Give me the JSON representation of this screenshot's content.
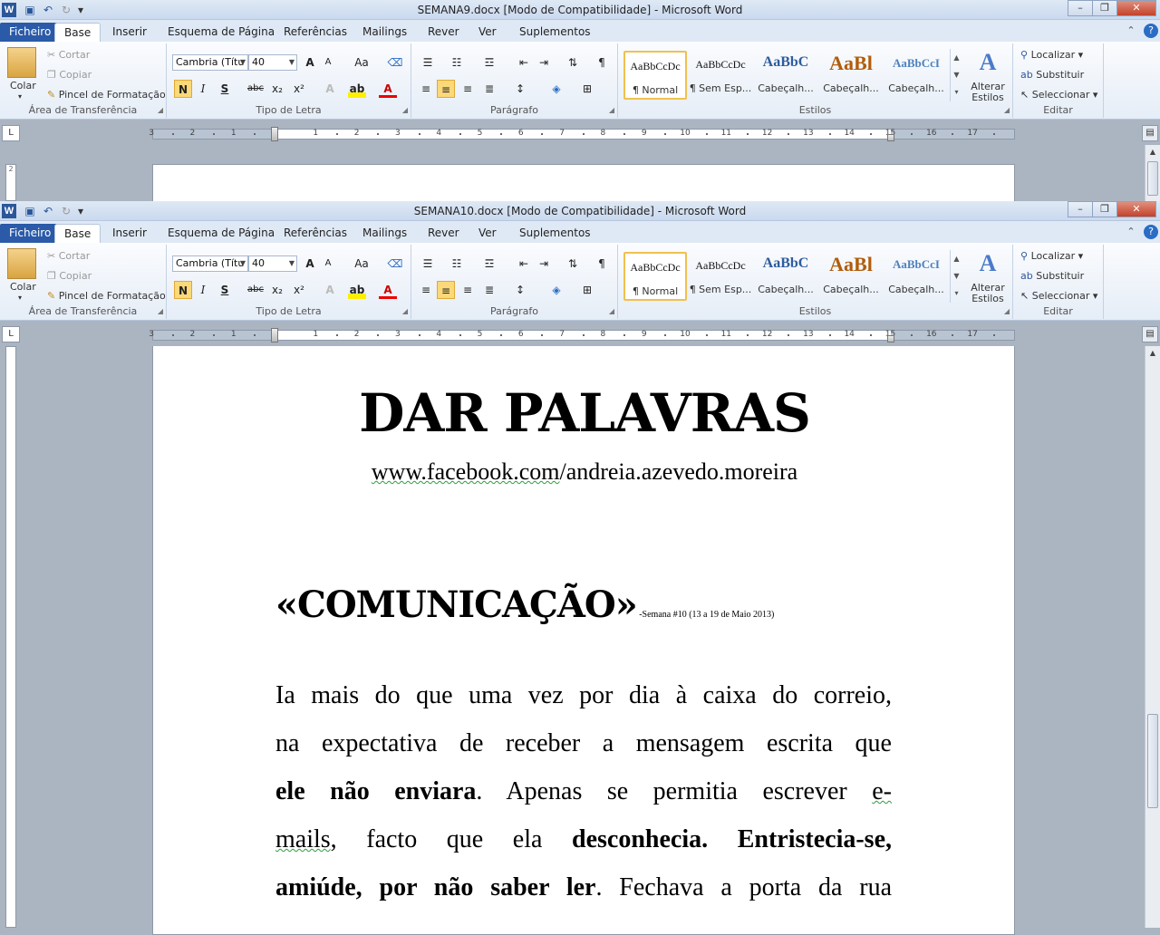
{
  "quick_access": {
    "save_icon": "save-icon",
    "undo_icon": "undo-icon",
    "redo_icon": "redo-icon",
    "customize_icon": "customize-qat-icon"
  },
  "windows": [
    {
      "title": "SEMANA9.docx [Modo de Compatibilidade]  -  Microsoft Word"
    },
    {
      "title": "SEMANA10.docx [Modo de Compatibilidade]  -  Microsoft Word"
    }
  ],
  "window_controls": {
    "minimize": "–",
    "restore": "❐",
    "close": "✕"
  },
  "tabs": [
    "Ficheiro",
    "Base",
    "Inserir",
    "Esquema de Página",
    "Referências",
    "Mailings",
    "Rever",
    "Ver",
    "Suplementos"
  ],
  "active_tab": "Base",
  "ribbon": {
    "clipboard": {
      "label": "Área de Transferência",
      "paste": "Colar",
      "cut": "Cortar",
      "copy": "Copiar",
      "format_painter": "Pincel de Formatação"
    },
    "font": {
      "label": "Tipo de Letra",
      "font_name": "Cambria (Títu",
      "font_size": "40",
      "bold": "N",
      "italic": "I",
      "underline": "S",
      "strike": "abc",
      "subscript": "x₂",
      "superscript": "x²",
      "grow": "A",
      "shrink": "A",
      "case": "Aa"
    },
    "paragraph": {
      "label": "Parágrafo",
      "pilcrow": "¶"
    },
    "styles": {
      "label": "Estilos",
      "items": [
        {
          "preview": "AaBbCcDc",
          "name": "¶ Normal",
          "selected": true
        },
        {
          "preview": "AaBbCcDc",
          "name": "¶ Sem Esp..."
        },
        {
          "preview": "AaBbC",
          "name": "Cabeçalh..."
        },
        {
          "preview": "AaBl",
          "name": "Cabeçalh..."
        },
        {
          "preview": "AaBbCcI",
          "name": "Cabeçalh..."
        }
      ],
      "change_styles": "Alterar Estilos"
    },
    "editing": {
      "label": "Editar",
      "find": "Localizar",
      "replace": "Substituir",
      "select": "Seleccionar"
    }
  },
  "ruler": {
    "numbers": [
      "3",
      "2",
      "1",
      "1",
      "2",
      "3",
      "4",
      "5",
      "6",
      "7",
      "8",
      "9",
      "10",
      "11",
      "12",
      "13",
      "14",
      "15",
      "16",
      "17"
    ]
  },
  "document": {
    "title": "DAR PALAVRAS",
    "url_part1": "www.facebook.com",
    "url_part2": "/andreia.azevedo.moreira",
    "heading": "«COMUNICAÇÃO»",
    "heading_dash": " -",
    "heading_note": "Semana #10 (13 a 19 de Maio 2013)",
    "line1": "Ia mais do que uma vez por dia à caixa do correio,",
    "line2": "na expectativa de receber a mensagem escrita que",
    "line3_bold": "ele não enviara",
    "line3_rest": ". Apenas se permitia escrever ",
    "line3_sq": "e-",
    "line4_sq": "mails",
    "line4_rest": ", facto que ela ",
    "line4_bold": "desconhecia. Entristecia-se,",
    "line5_bold": "amiúde, por não saber ler",
    "line5_rest": ". Fechava a porta da rua"
  },
  "colors": {
    "file_tab": "#2a5aa8",
    "ribbon_bg": "#e5edf7",
    "workspace": "#abb4c1",
    "selected_style": "#f0c050",
    "spelling_squiggle": "#2a9d3d"
  }
}
